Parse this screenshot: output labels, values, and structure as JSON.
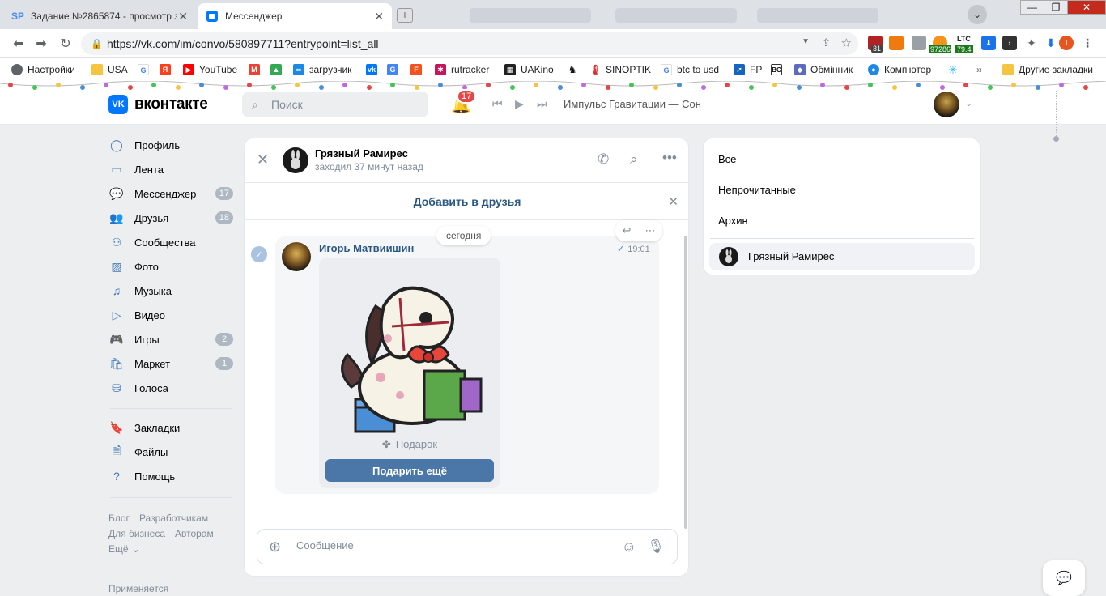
{
  "browser": {
    "tabs": [
      {
        "title": "Задание №2865874 - просмотр з",
        "favicon": "SP"
      },
      {
        "title": "Мессенджер",
        "favicon": "chat-icon"
      }
    ],
    "url": "https://vk.com/im/convo/580897711?entrypoint=list_all",
    "bookmarks": [
      "Настройки",
      "USA",
      "YouTube",
      "загрузчик",
      "rutracker",
      "UAKino",
      "SINOPTIK",
      "btc to usd",
      "FP",
      "Обмінник",
      "Комп'ютер",
      "Другие закладки"
    ],
    "ext_labels": {
      "calendar": "31",
      "btc_price": "97286",
      "ltc_label": "LTC",
      "ltc_price": "79.4"
    }
  },
  "vk": {
    "logo_text": "вконтакте",
    "logo_mark": "VK",
    "search_placeholder": "Поиск",
    "notifications": "17",
    "track": "Импульс Гравитации — Сон"
  },
  "nav": [
    {
      "label": "Профиль",
      "icon": "profile-icon",
      "count": ""
    },
    {
      "label": "Лента",
      "icon": "feed-icon",
      "count": ""
    },
    {
      "label": "Мессенджер",
      "icon": "messenger-icon",
      "count": "17"
    },
    {
      "label": "Друзья",
      "icon": "friends-icon",
      "count": "18"
    },
    {
      "label": "Сообщества",
      "icon": "communities-icon",
      "count": ""
    },
    {
      "label": "Фото",
      "icon": "photo-icon",
      "count": ""
    },
    {
      "label": "Музыка",
      "icon": "music-icon",
      "count": ""
    },
    {
      "label": "Видео",
      "icon": "video-icon",
      "count": ""
    },
    {
      "label": "Игры",
      "icon": "games-icon",
      "count": "2"
    },
    {
      "label": "Маркет",
      "icon": "market-icon",
      "count": "1"
    },
    {
      "label": "Голоса",
      "icon": "votes-icon",
      "count": ""
    }
  ],
  "nav2": [
    {
      "label": "Закладки",
      "icon": "bookmark-icon"
    },
    {
      "label": "Файлы",
      "icon": "files-icon"
    },
    {
      "label": "Помощь",
      "icon": "help-icon"
    }
  ],
  "footer": {
    "row1": [
      "Блог",
      "Разработчикам"
    ],
    "row2": [
      "Для бизнеса",
      "Авторам"
    ],
    "row3": "Ещё",
    "row4": "Применяется"
  },
  "chat": {
    "name": "Грязный Рамирес",
    "status": "заходил 37 минут назад",
    "add_friend": "Добавить в друзья",
    "date_pill": "сегодня",
    "message": {
      "sender": "Игорь Матвиишин",
      "time": "19:01",
      "gift_label": "Подарок",
      "gift_button": "Подарить ещё"
    },
    "composer_placeholder": "Сообщение"
  },
  "filters": [
    "Все",
    "Непрочитанные",
    "Архив"
  ],
  "selected_chat": "Грязный Рамирес",
  "colors": {
    "vk_blue": "#0077ff",
    "link": "#2a5885",
    "button": "#4a76a8",
    "badge": "#e64646"
  }
}
